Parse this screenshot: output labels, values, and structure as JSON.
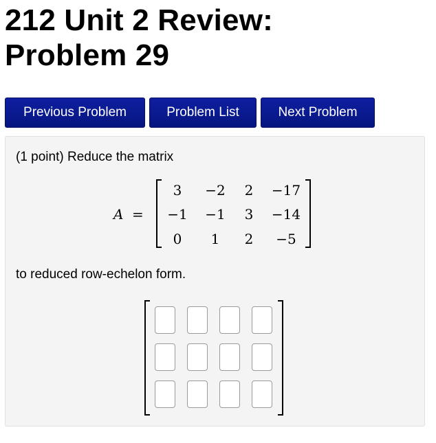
{
  "page": {
    "title_line1": "212 Unit 2 Review:",
    "title_line2": "Problem 29"
  },
  "nav": {
    "previous_label": "Previous Problem",
    "list_label": "Problem List",
    "next_label": "Next Problem"
  },
  "problem": {
    "intro": "(1 point) Reduce the matrix",
    "matrix_name": "A",
    "equals": "=",
    "matrix": [
      [
        "3",
        "−2",
        "2",
        "−17"
      ],
      [
        "−1",
        "−1",
        "3",
        "−14"
      ],
      [
        "0",
        "1",
        "2",
        "−5"
      ]
    ],
    "instruction": "to reduced row-echelon form.",
    "answer_inputs": [
      [
        "",
        "",
        "",
        ""
      ],
      [
        "",
        "",
        "",
        ""
      ],
      [
        "",
        "",
        "",
        ""
      ]
    ]
  },
  "colors": {
    "button_bg": "#0a1a8a",
    "button_text": "#ffffff",
    "panel_bg": "#f4f4f4"
  }
}
